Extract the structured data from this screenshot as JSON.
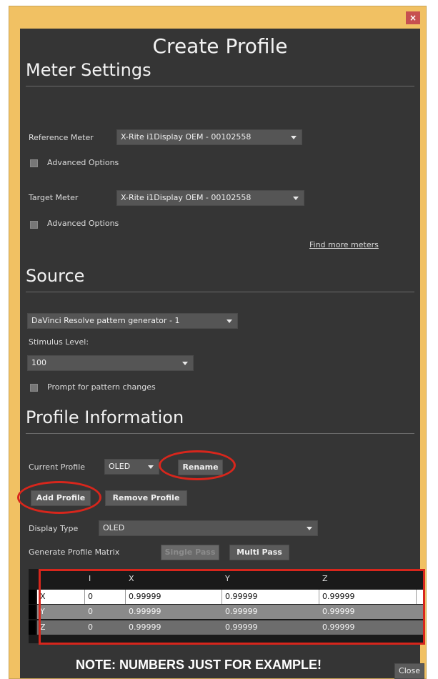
{
  "window": {
    "close_glyph": "×",
    "title": "Create Profile"
  },
  "meter_settings": {
    "heading": "Meter Settings",
    "reference_label": "Reference Meter",
    "reference_value": "X-Rite i1Display OEM - 00102558",
    "reference_advanced_label": "Advanced Options",
    "target_label": "Target Meter",
    "target_value": "X-Rite i1Display OEM - 00102558",
    "target_advanced_label": "Advanced Options",
    "find_more_link": "Find more meters"
  },
  "source": {
    "heading": "Source",
    "source_value": "DaVinci Resolve pattern generator - 1",
    "stimulus_label": "Stimulus Level:",
    "stimulus_value": "100",
    "prompt_label": "Prompt for pattern changes"
  },
  "profile_info": {
    "heading": "Profile Information",
    "current_profile_label": "Current Profile",
    "current_profile_value": "OLED",
    "rename_label": "Rename",
    "add_profile_label": "Add Profile",
    "remove_profile_label": "Remove Profile",
    "display_type_label": "Display Type",
    "display_type_value": "OLED",
    "generate_matrix_label": "Generate Profile Matrix",
    "single_pass_label": "Single Pass",
    "multi_pass_label": "Multi Pass"
  },
  "matrix": {
    "columns": [
      "",
      "I",
      "X",
      "Y",
      "Z"
    ],
    "rows": [
      [
        "X",
        "0",
        "0.99999",
        "0.99999",
        "0.99999"
      ],
      [
        "Y",
        "0",
        "0.99999",
        "0.99999",
        "0.99999"
      ],
      [
        "Z",
        "0",
        "0.99999",
        "0.99999",
        "0.99999"
      ]
    ]
  },
  "footer": {
    "note": "NOTE: NUMBERS JUST FOR EXAMPLE!",
    "close_label": "Close"
  },
  "colors": {
    "window_frame": "#f1c163",
    "client_bg": "#353535",
    "highlight_ring": "#d7261c",
    "close_button": "#c75050"
  }
}
